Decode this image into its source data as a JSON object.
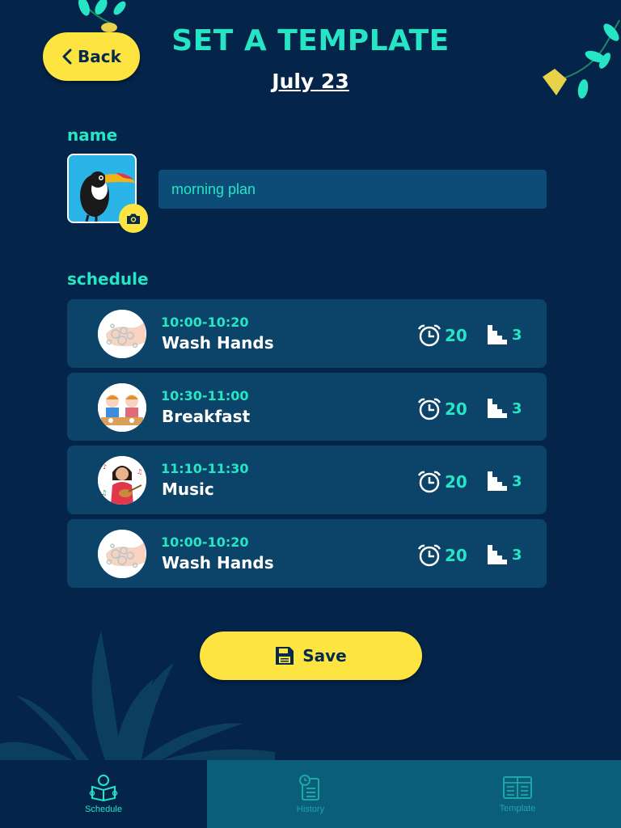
{
  "header": {
    "back_label": "Back",
    "title": "SET A TEMPLATE",
    "date": "July 23"
  },
  "name_section": {
    "label": "name",
    "input_value": "morning plan",
    "avatar_icon": "toucan-icon",
    "camera_icon": "camera-icon"
  },
  "schedule_section": {
    "label": "schedule",
    "tasks": [
      {
        "time": "10:00-10:20",
        "name": "Wash Hands",
        "duration": "20",
        "steps": "3",
        "icon": "wash-hands-icon"
      },
      {
        "time": "10:30-11:00",
        "name": "Breakfast",
        "duration": "20",
        "steps": "3",
        "icon": "breakfast-icon"
      },
      {
        "time": "11:10-11:30",
        "name": "Music",
        "duration": "20",
        "steps": "3",
        "icon": "music-icon"
      },
      {
        "time": "10:00-10:20",
        "name": "Wash Hands",
        "duration": "20",
        "steps": "3",
        "icon": "wash-hands-icon"
      }
    ]
  },
  "save_label": "Save",
  "tabs": [
    {
      "label": "Schedule",
      "icon": "reader-icon",
      "active": true
    },
    {
      "label": "History",
      "icon": "history-icon",
      "active": false
    },
    {
      "label": "Template",
      "icon": "template-icon",
      "active": false
    }
  ],
  "colors": {
    "background": "#04244a",
    "accent": "#25e5c4",
    "button": "#fde440",
    "card": "#0c4368"
  }
}
